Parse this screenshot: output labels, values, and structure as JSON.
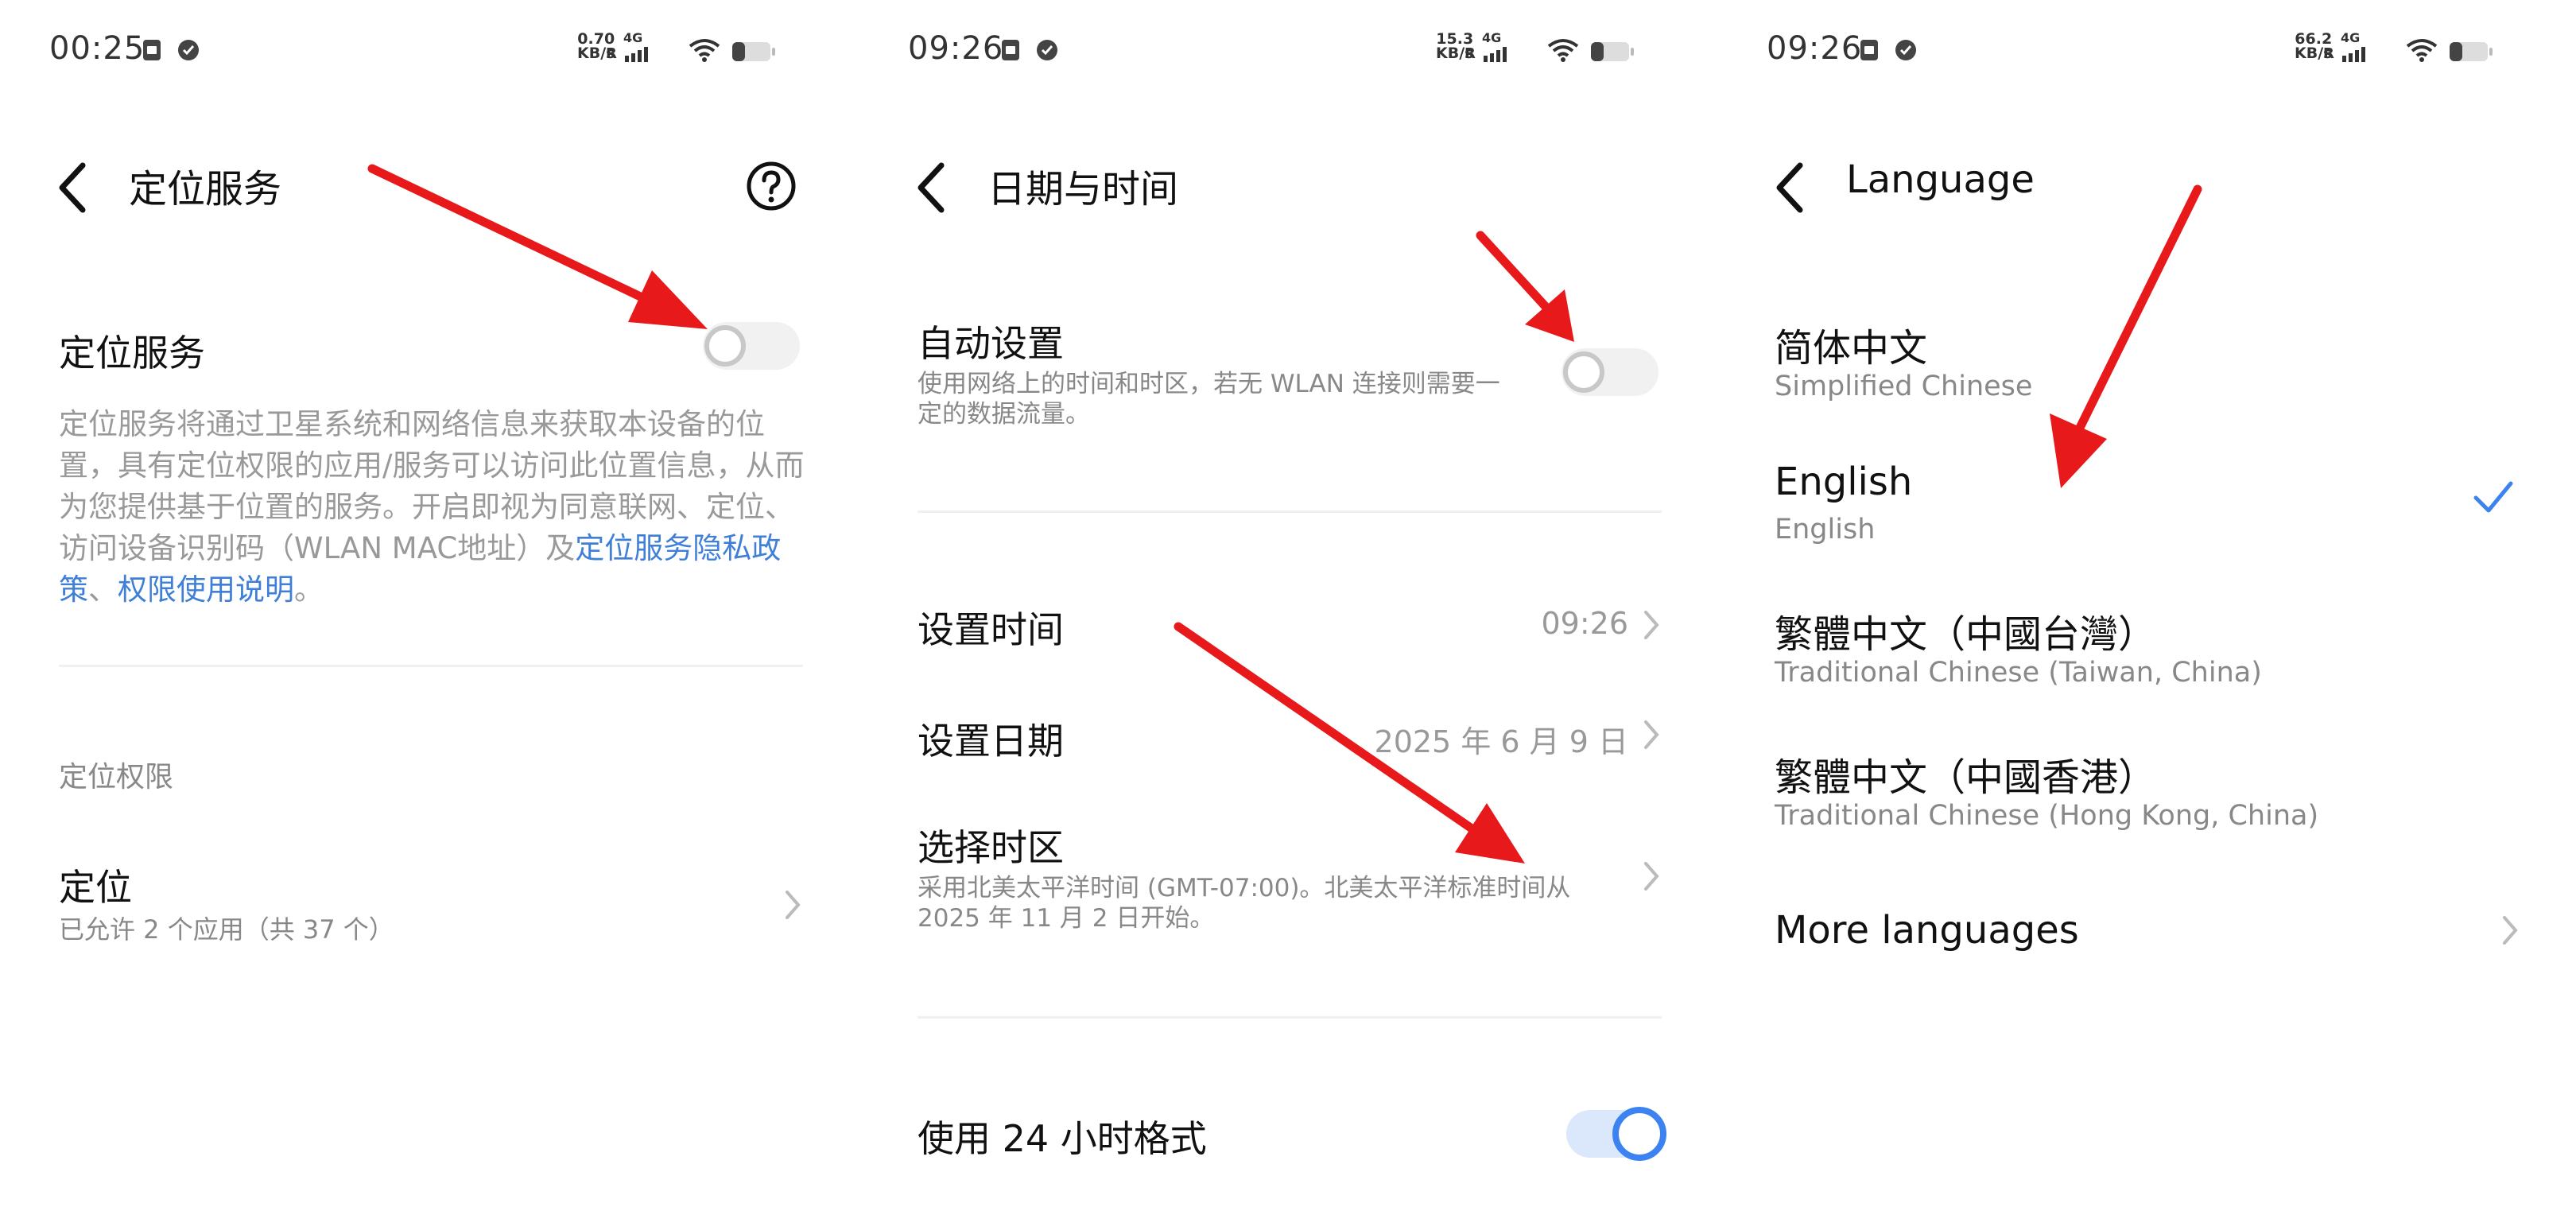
{
  "colors": {
    "accent": "#3c82f0",
    "link": "#3f7fd8",
    "arrow": "#e8191b"
  },
  "panels": [
    {
      "status": {
        "time": "00:25",
        "net_top": "0.70",
        "net_bottom": "KB/s",
        "net_type": "4G",
        "roaming": "R"
      },
      "title": "定位服务",
      "toggle_label": "定位服务",
      "description": "定位服务将通过卫星系统和网络信息来获取本设备的位置，具有定位权限的应用/服务可以访问此位置信息，从而为您提供基于位置的服务。开启即视为同意联网、定位、访问设备识别码（WLAN MAC地址）及",
      "link1": "定位服务隐私政策",
      "sep": "、",
      "link2": "权限使用说明",
      "end": "。",
      "section": "定位权限",
      "location_title": "定位",
      "location_sub": "已允许 2 个应用（共 37 个）"
    },
    {
      "status": {
        "time": "09:26",
        "net_top": "15.3",
        "net_bottom": "KB/s",
        "net_type": "4G",
        "roaming": "R"
      },
      "title": "日期与时间",
      "auto_title": "自动设置",
      "auto_sub": "使用网络上的时间和时区，若无 WLAN 连接则需要一定的数据流量。",
      "set_time": "设置时间",
      "set_time_value": "09:26",
      "set_date": "设置日期",
      "set_date_value": "2025 年 6 月 9 日",
      "tz_title": "选择时区",
      "tz_sub": "采用北美太平洋时间 (GMT-07:00)。北美太平洋标准时间从 2025 年 11 月 2 日开始。",
      "h24": "使用 24 小时格式"
    },
    {
      "status": {
        "time": "09:26",
        "net_top": "66.2",
        "net_bottom": "KB/s",
        "net_type": "4G",
        "roaming": "R"
      },
      "title": "Language",
      "languages": [
        {
          "name": "简体中文",
          "sub": "Simplified Chinese"
        },
        {
          "name": "English",
          "sub": "English"
        },
        {
          "name": "繁體中文（中國台灣）",
          "sub": "Traditional Chinese (Taiwan, China)"
        },
        {
          "name": "繁體中文（中國香港）",
          "sub": "Traditional Chinese (Hong Kong, China)"
        }
      ],
      "more": "More languages"
    }
  ]
}
